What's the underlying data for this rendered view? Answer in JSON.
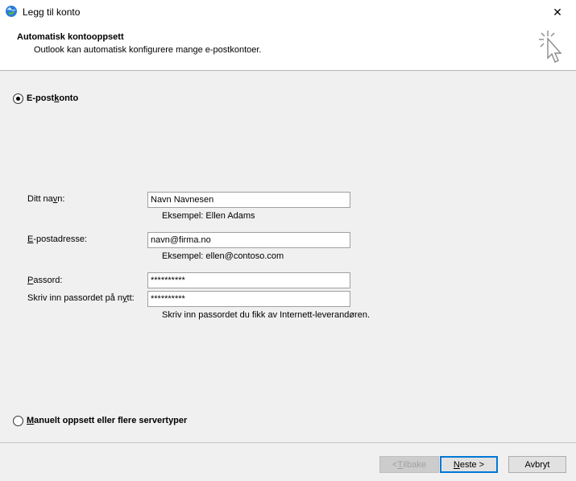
{
  "window": {
    "title": "Legg til konto",
    "close_glyph": "✕",
    "icon": "outlook-globe-icon"
  },
  "header": {
    "title": "Automatisk kontooppsett",
    "subtitle": "Outlook kan automatisk konfigurere mange e-postkontoer.",
    "icon": "cursor-click-icon"
  },
  "options": {
    "email_account": {
      "label_pre": "E-post",
      "label_u": "k",
      "label_post": "onto",
      "selected": true
    },
    "manual": {
      "label_pre": "",
      "label_u": "M",
      "label_post": "anuelt oppsett eller flere servertyper",
      "selected": false
    }
  },
  "form": {
    "name": {
      "label_pre": "Ditt na",
      "label_u": "v",
      "label_post": "n:",
      "value": "Navn Navnesen",
      "hint": "Eksempel: Ellen Adams"
    },
    "email": {
      "label_pre": "",
      "label_u": "E",
      "label_post": "-postadresse:",
      "value": "navn@firma.no",
      "hint": "Eksempel: ellen@contoso.com"
    },
    "password": {
      "label_pre": "",
      "label_u": "P",
      "label_post": "assord:",
      "value": "**********"
    },
    "password_repeat": {
      "label_pre": "Skriv inn passordet på n",
      "label_u": "y",
      "label_post": "tt:",
      "value": "**********",
      "hint": "Skriv inn passordet du fikk av Internett-leverandøren."
    }
  },
  "buttons": {
    "back": {
      "pre": "< ",
      "u": "T",
      "post": "ilbake"
    },
    "next": {
      "pre": "",
      "u": "N",
      "post": "este >"
    },
    "cancel": {
      "label": "Avbryt"
    }
  }
}
